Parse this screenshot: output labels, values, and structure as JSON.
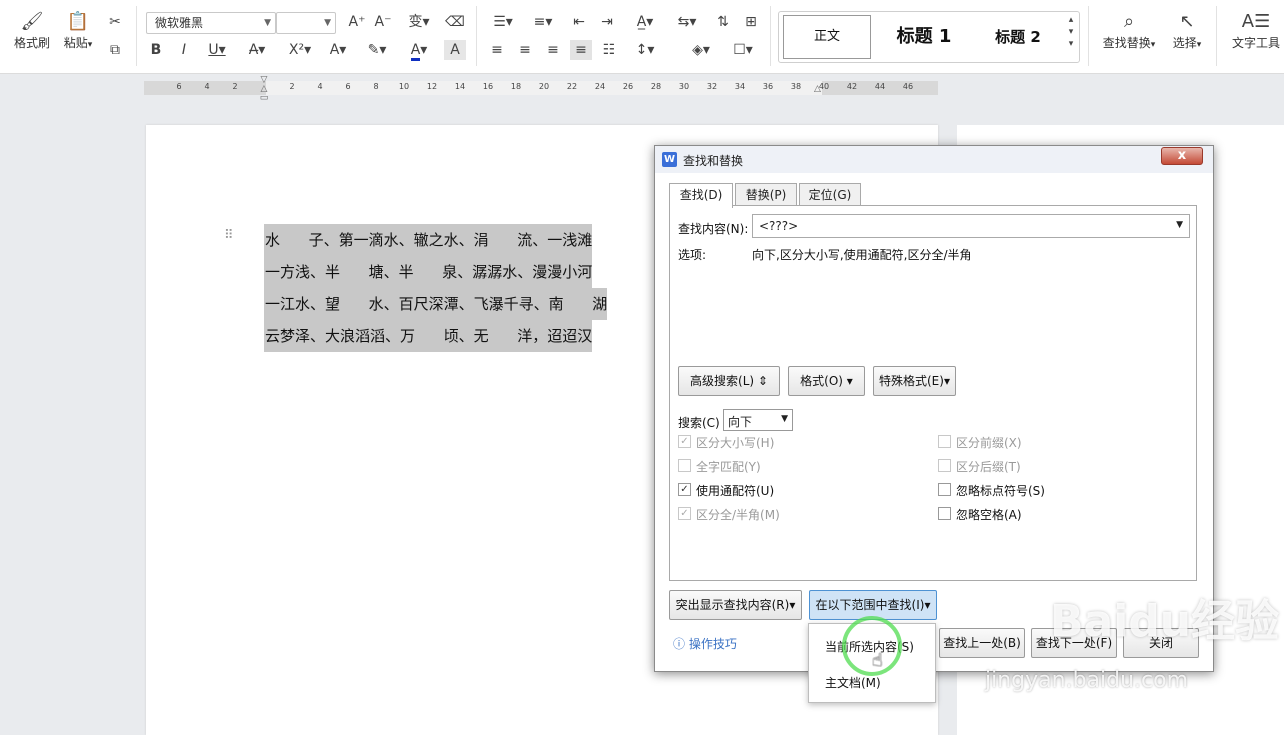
{
  "ribbon": {
    "format_painter": "格式刷",
    "paste": "粘贴",
    "font_name": "微软雅黑",
    "font_size": "",
    "style_body": "正文",
    "style_h1": "标题 1",
    "style_h2": "标题 2",
    "find_replace": "查找替换",
    "select": "选择",
    "text_tools": "文字工具"
  },
  "ruler": {
    "ticks": [
      "6",
      "4",
      "2",
      "2",
      "4",
      "6",
      "8",
      "10",
      "12",
      "14",
      "16",
      "18",
      "20",
      "22",
      "24",
      "26",
      "28",
      "30",
      "32",
      "34",
      "36",
      "38",
      "40",
      "42",
      "44",
      "46"
    ]
  },
  "document": {
    "lines": [
      "水      子、第一滴水、辙之水、涓      流、一浅滩",
      "一方浅、半      塘、半      泉、潺潺水、漫漫小河",
      "一江水、望      水、百尺深潭、飞瀑千寻、南      湖",
      "云梦泽、大浪滔滔、万      顷、无      洋，迢迢汉"
    ]
  },
  "dialog": {
    "title": "查找和替换",
    "close": "x",
    "tabs": [
      "查找(D)",
      "替换(P)",
      "定位(G)"
    ],
    "find_label": "查找内容(N):",
    "find_value": "<???>",
    "options_label": "选项:",
    "options_value": "向下,区分大小写,使用通配符,区分全/半角",
    "advanced_button": "高级搜索(L)",
    "format_button": "格式(O)",
    "special_button": "特殊格式(E)",
    "search_label": "搜索(C)",
    "search_value": "向下",
    "checkboxes_left": [
      {
        "label": "区分大小写(H)",
        "checked": true,
        "disabled": true
      },
      {
        "label": "全字匹配(Y)",
        "checked": false,
        "disabled": true
      },
      {
        "label": "使用通配符(U)",
        "checked": true,
        "disabled": false
      },
      {
        "label": "区分全/半角(M)",
        "checked": true,
        "disabled": true
      }
    ],
    "checkboxes_right": [
      {
        "label": "区分前缀(X)",
        "checked": false,
        "disabled": true
      },
      {
        "label": "区分后缀(T)",
        "checked": false,
        "disabled": true
      },
      {
        "label": "忽略标点符号(S)",
        "checked": false,
        "disabled": false
      },
      {
        "label": "忽略空格(A)",
        "checked": false,
        "disabled": false
      }
    ],
    "highlight_button": "突出显示查找内容(R)",
    "find_in_button": "在以下范围中查找(I)",
    "tips_link": "操作技巧",
    "find_prev_button": "查找上一处(B)",
    "find_next_button": "查找下一处(F)",
    "close_button": "关闭"
  },
  "dropdown": {
    "items": [
      "当前所选内容(S)",
      "主文档(M)"
    ]
  },
  "watermark": {
    "brand": "Baidu经验",
    "url": "jingyan.baidu.com"
  }
}
